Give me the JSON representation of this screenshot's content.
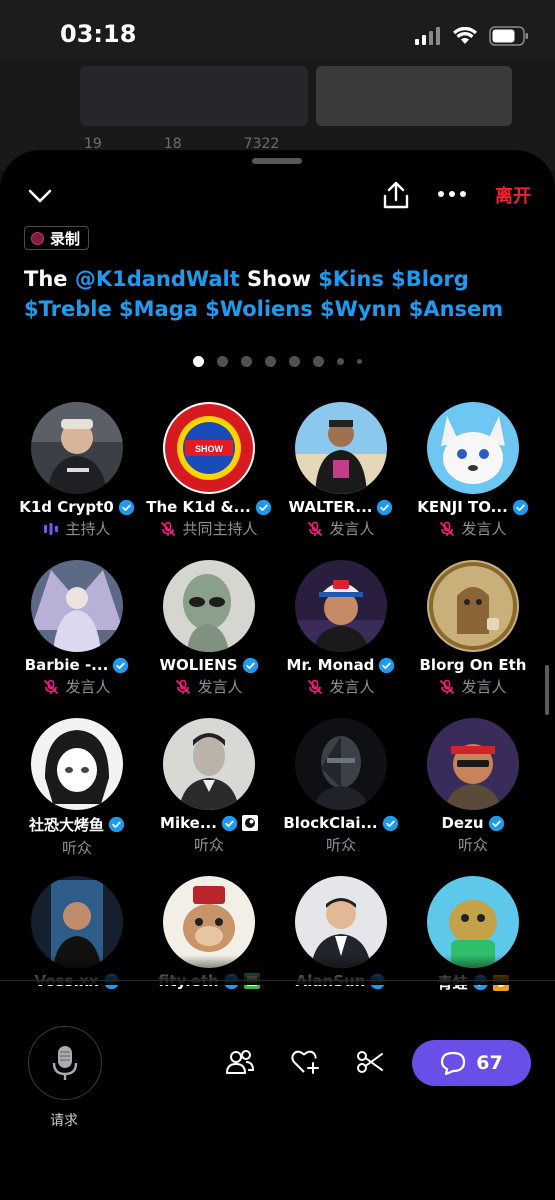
{
  "status_bar": {
    "time": "03:18"
  },
  "background_post": {
    "stats": [
      "19",
      "18",
      "7322"
    ]
  },
  "header": {
    "leave_label": "离开",
    "recording_badge": "录制",
    "title_parts": {
      "p1": "The ",
      "p2": "@K1dandWalt",
      "p3": " Show ",
      "p4": "$Kins $Blorg $Treble $Maga $Woliens $Wynn $Ansem"
    }
  },
  "page_dots": {
    "count": 8,
    "active": 0
  },
  "participants": [
    {
      "name": "K1d Crypt0",
      "role": "主持人",
      "verified": true,
      "mic": "active"
    },
    {
      "name": "The K1d &...",
      "role": "共同主持人",
      "verified": true,
      "mic": "muted"
    },
    {
      "name": "WALTER...",
      "role": "发言人",
      "verified": true,
      "mic": "muted"
    },
    {
      "name": "KENJI TO...",
      "role": "发言人",
      "verified": true,
      "mic": "muted"
    },
    {
      "name": "Barbie -...",
      "role": "发言人",
      "verified": true,
      "mic": "muted"
    },
    {
      "name": "WOLIENS",
      "role": "发言人",
      "verified": true,
      "mic": "muted"
    },
    {
      "name": "Mr. Monad",
      "role": "发言人",
      "verified": true,
      "mic": "muted"
    },
    {
      "name": "Blorg On Eth",
      "role": "发言人",
      "verified": false,
      "mic": "muted"
    },
    {
      "name": "社恐大烤鱼",
      "role": "听众",
      "verified": true,
      "mic": "none"
    },
    {
      "name": "Mike...",
      "role": "听众",
      "verified": true,
      "mic": "none"
    },
    {
      "name": "BlockClai...",
      "role": "听众",
      "verified": true,
      "mic": "none"
    },
    {
      "name": "Dezu",
      "role": "听众",
      "verified": true,
      "mic": "none"
    },
    {
      "name": "Voss.xx",
      "role": "",
      "verified": true,
      "mic": "none"
    },
    {
      "name": "fity.eth",
      "role": "",
      "verified": true,
      "mic": "none"
    },
    {
      "name": "AlanSun",
      "role": "",
      "verified": true,
      "mic": "none"
    },
    {
      "name": "青蛙",
      "role": "",
      "verified": true,
      "mic": "none"
    }
  ],
  "bottom_bar": {
    "request_label": "请求",
    "comments_count": "67"
  },
  "colors": {
    "accent": "#1d9bf0",
    "leave": "#f4212e",
    "chat_button": "#6a4ee8",
    "muted_icon": "#f91880"
  }
}
